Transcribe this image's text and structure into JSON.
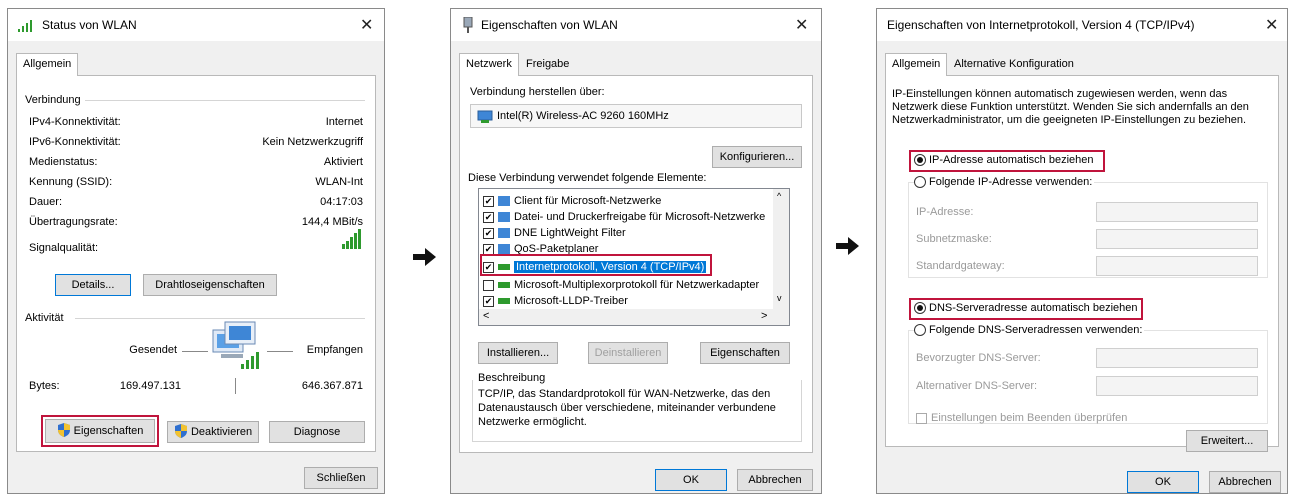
{
  "status_dialog": {
    "title": "Status von WLAN",
    "tab": "Allgemein",
    "connection_group": "Verbindung",
    "rows": [
      {
        "label": "IPv4-Konnektivität:",
        "value": "Internet"
      },
      {
        "label": "IPv6-Konnektivität:",
        "value": "Kein Netzwerkzugriff"
      },
      {
        "label": "Medienstatus:",
        "value": "Aktiviert"
      },
      {
        "label": "Kennung (SSID):",
        "value": "WLAN-Int"
      },
      {
        "label": "Dauer:",
        "value": "04:17:03"
      },
      {
        "label": "Übertragungsrate:",
        "value": "144,4 MBit/s"
      }
    ],
    "signal_label": "Signalqualität:",
    "details_button": "Details...",
    "wireless_button": "Drahtloseigenschaften",
    "activity_group": "Aktivität",
    "sent_label": "Gesendet",
    "received_label": "Empfangen",
    "bytes_label": "Bytes:",
    "bytes_sent": "169.497.131",
    "bytes_received": "646.367.871",
    "properties_button": "Eigenschaften",
    "deactivate_button": "Deaktivieren",
    "diagnose_button": "Diagnose",
    "close_button": "Schließen"
  },
  "properties_dialog": {
    "title": "Eigenschaften von WLAN",
    "tabs": [
      "Netzwerk",
      "Freigabe"
    ],
    "connect_using_label": "Verbindung herstellen über:",
    "adapter_name": "Intel(R) Wireless-AC 9260 160MHz",
    "configure_button": "Konfigurieren...",
    "elements_label": "Diese Verbindung verwendet folgende Elemente:",
    "items": [
      {
        "label": "Client für Microsoft-Netzwerke",
        "checked": true
      },
      {
        "label": "Datei- und Druckerfreigabe für Microsoft-Netzwerke",
        "checked": true
      },
      {
        "label": "DNE LightWeight Filter",
        "checked": true
      },
      {
        "label": "QoS-Paketplaner",
        "checked": true
      },
      {
        "label": "Internetprotokoll, Version 4 (TCP/IPv4)",
        "checked": true,
        "selected": true
      },
      {
        "label": "Microsoft-Multiplexorprotokoll für Netzwerkadapter",
        "checked": false
      },
      {
        "label": "Microsoft-LLDP-Treiber",
        "checked": true
      }
    ],
    "install_button": "Installieren...",
    "uninstall_button": "Deinstallieren",
    "properties_button": "Eigenschaften",
    "description_title": "Beschreibung",
    "description_text_1": "TCP/IP, das Standardprotokoll für WAN-Netzwerke, das den",
    "description_text_2": "Datenaustausch über verschiedene, miteinander verbundene",
    "description_text_3": "Netzwerke ermöglicht.",
    "ok_button": "OK",
    "cancel_button": "Abbrechen"
  },
  "ipv4_dialog": {
    "title": "Eigenschaften von Internetprotokoll, Version 4 (TCP/IPv4)",
    "tabs": [
      "Allgemein",
      "Alternative Konfiguration"
    ],
    "intro_1": "IP-Einstellungen können automatisch zugewiesen werden, wenn das",
    "intro_2": "Netzwerk diese Funktion unterstützt. Wenden Sie sich andernfalls an den",
    "intro_3": "Netzwerkadministrator, um die geeigneten IP-Einstellungen zu beziehen.",
    "ip_auto_label": "IP-Adresse automatisch beziehen",
    "ip_manual_label": "Folgende IP-Adresse verwenden:",
    "ip_address_label": "IP-Adresse:",
    "subnet_label": "Subnetzmaske:",
    "gateway_label": "Standardgateway:",
    "dns_auto_label": "DNS-Serveradresse automatisch beziehen",
    "dns_manual_label": "Folgende DNS-Serveradressen verwenden:",
    "preferred_dns_label": "Bevorzugter DNS-Server:",
    "alternate_dns_label": "Alternativer DNS-Server:",
    "validate_label": "Einstellungen beim Beenden überprüfen",
    "advanced_button": "Erweitert...",
    "ok_button": "OK",
    "cancel_button": "Abbrechen"
  },
  "colors": {
    "highlight": "#c0143c",
    "selection": "#0078d7",
    "signal": "#2e9a2e"
  }
}
